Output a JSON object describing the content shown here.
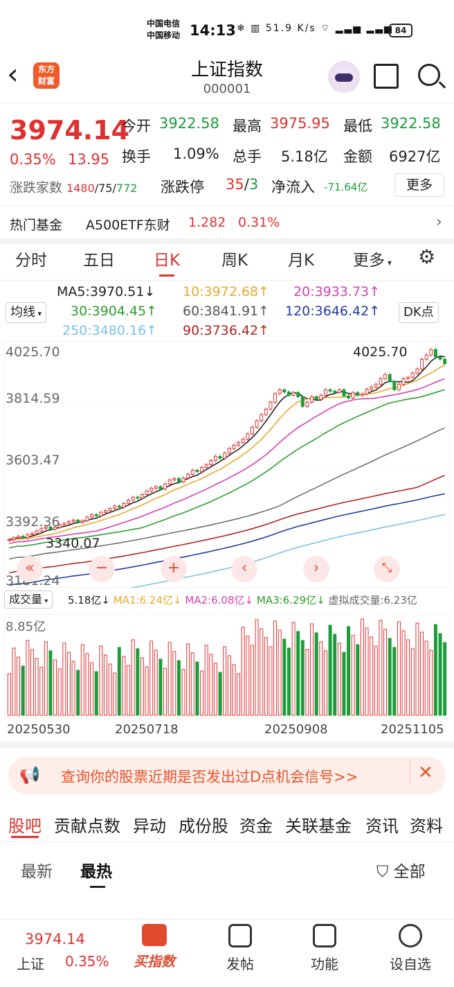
{
  "status_bar": {
    "carrier1": "中国电信",
    "carrier2": "中国移动",
    "time": "14:13",
    "net_speed": "51.9",
    "net_unit": "K/s",
    "battery": "84"
  },
  "header": {
    "logo_text_1": "东方",
    "logo_text_2": "财富",
    "title": "上证指数",
    "code": "000001"
  },
  "quote": {
    "price": "3974.14",
    "change_pct": "0.35%",
    "change": "13.95",
    "open_label": "今开",
    "open": "3922.58",
    "high_label": "最高",
    "high": "3975.95",
    "low_label": "最低",
    "low": "3922.58",
    "turnover_label": "换手",
    "turnover": "1.09%",
    "volume_label": "总手",
    "volume": "5.18亿",
    "amount_label": "金额",
    "amount": "6927亿",
    "updown_label": "涨跌家数",
    "up": "1480",
    "flat": "75",
    "down": "772",
    "limit_label": "涨跌停",
    "limit_up": "35",
    "limit_down": "3",
    "netflow_label": "净流入",
    "netflow": "-71.64亿",
    "more": "更多"
  },
  "hot_fund": {
    "label": "热门基金",
    "name": "A500ETF东财",
    "price": "1.282",
    "pct": "0.31%"
  },
  "tabs": [
    "分时",
    "五日",
    "日K",
    "周K",
    "月K",
    "更多"
  ],
  "active_tab": 2,
  "ma": {
    "selector": "均线",
    "dk": "DK点",
    "ma5": "MA5:3970.51↓",
    "ma10": "10:3972.68↑",
    "ma20": "20:3933.73↑",
    "ma30": "30:3904.45↑",
    "ma60": "60:3841.91↑",
    "ma120": "120:3646.42↑",
    "ma250": "250:3480.16↑",
    "ma90": "90:3736.42↑"
  },
  "chart_data": {
    "type": "candlestick",
    "y_ticks": [
      "4025.70",
      "3814.59",
      "3603.47",
      "3392.36",
      "3181.24"
    ],
    "ylim": [
      3181.24,
      4025.7
    ],
    "max_label": "4025.70",
    "min_label": "3340.07",
    "close": [
      3340,
      3347,
      3352,
      3346,
      3358,
      3362,
      3371,
      3380,
      3385,
      3377,
      3384,
      3393,
      3398,
      3405,
      3410,
      3402,
      3408,
      3421,
      3430,
      3425,
      3438,
      3444,
      3452,
      3461,
      3457,
      3470,
      3482,
      3493,
      3489,
      3502,
      3515,
      3525,
      3531,
      3522,
      3540,
      3555,
      3560,
      3548,
      3562,
      3575,
      3590,
      3585,
      3600,
      3610,
      3625,
      3640,
      3633,
      3652,
      3668,
      3680,
      3690,
      3702,
      3721,
      3745,
      3768,
      3790,
      3810,
      3835,
      3866,
      3880,
      3872,
      3860,
      3870,
      3855,
      3820,
      3835,
      3855,
      3845,
      3860,
      3880,
      3875,
      3870,
      3880,
      3858,
      3850,
      3870,
      3860,
      3865,
      3882,
      3890,
      3900,
      3920,
      3935,
      3910,
      3880,
      3900,
      3920,
      3925,
      3940,
      3955,
      3990,
      4005,
      4025,
      3998,
      3990,
      3974
    ],
    "colors": {
      "ma5": "#222222",
      "ma10": "#e8a92c",
      "ma20": "#d63fb0",
      "ma30": "#2ba02b",
      "ma60": "#707070",
      "ma90": "#b22222",
      "ma120": "#1f3c9c",
      "ma250": "#7cc0e8",
      "up": "#e03131",
      "down": "#1a9d3a"
    }
  },
  "volume": {
    "selector": "成交量",
    "value": "5.18亿↓",
    "ma1": "MA1:6.24亿↓",
    "ma2": "MA2:6.08亿↓",
    "ma3": "MA3:6.29亿↓",
    "virtual": "虚拟成交量:6.23亿",
    "max_label": "8.85亿",
    "dates": [
      "20250530",
      "20250718",
      "20250908",
      "20251105"
    ]
  },
  "banner": {
    "text": "查询你的股票近期是否发出过D点机会信号>>"
  },
  "sub_tabs": [
    "股吧",
    "贡献点数",
    "异动",
    "成份股",
    "资金",
    "关联基金",
    "资讯",
    "资料"
  ],
  "feed": {
    "latest": "最新",
    "hottest": "最热",
    "filter": "全部"
  },
  "bottom_nav": {
    "price": "3974.14",
    "name": "上证",
    "pct": "0.35%",
    "buy": "买指数",
    "post": "发帖",
    "func": "功能",
    "watch": "设自选"
  }
}
